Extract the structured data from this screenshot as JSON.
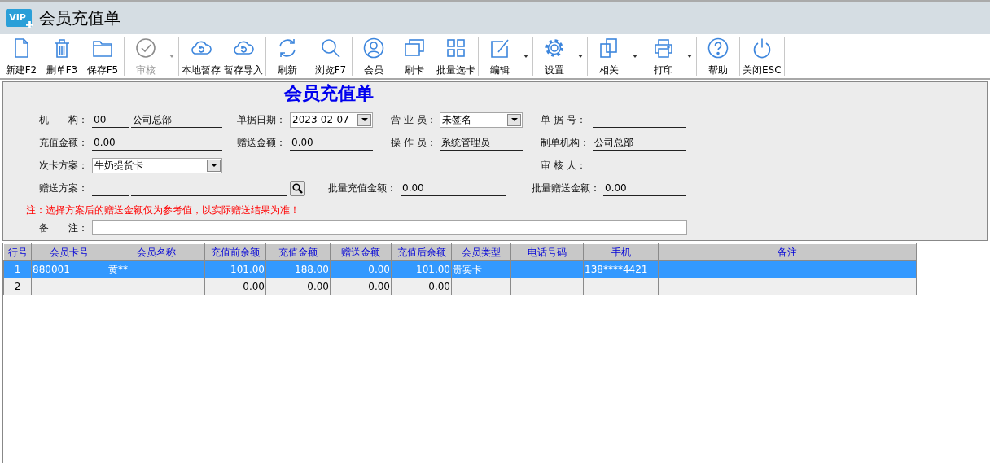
{
  "window": {
    "logo_text": "VIP",
    "title": "会员充值单"
  },
  "toolbar": [
    {
      "buttons": [
        {
          "label": "新建F2",
          "disabled": false,
          "has_menu": false
        },
        {
          "label": "删单F3",
          "disabled": false,
          "has_menu": false
        },
        {
          "label": "保存F5",
          "disabled": false,
          "has_menu": false
        }
      ]
    },
    {
      "buttons": [
        {
          "label": "审核",
          "disabled": true,
          "has_menu": true
        }
      ]
    },
    {
      "buttons": [
        {
          "label": "本地暂存",
          "disabled": false,
          "has_menu": false
        },
        {
          "label": "暂存导入",
          "disabled": false,
          "has_menu": false
        }
      ]
    },
    {
      "buttons": [
        {
          "label": "刷新",
          "disabled": false,
          "has_menu": false
        }
      ]
    },
    {
      "buttons": [
        {
          "label": "浏览F7",
          "disabled": false,
          "has_menu": false
        }
      ]
    },
    {
      "buttons": [
        {
          "label": "会员",
          "disabled": false,
          "has_menu": false
        },
        {
          "label": "刷卡",
          "disabled": false,
          "has_menu": false
        },
        {
          "label": "批量选卡",
          "disabled": false,
          "has_menu": false
        }
      ]
    },
    {
      "buttons": [
        {
          "label": "编辑",
          "disabled": false,
          "has_menu": true
        }
      ]
    },
    {
      "buttons": [
        {
          "label": "设置",
          "disabled": false,
          "has_menu": true
        }
      ]
    },
    {
      "buttons": [
        {
          "label": "相关",
          "disabled": false,
          "has_menu": true
        }
      ]
    },
    {
      "buttons": [
        {
          "label": "打印",
          "disabled": false,
          "has_menu": true
        }
      ]
    },
    {
      "buttons": [
        {
          "label": "帮助",
          "disabled": false,
          "has_menu": false
        }
      ]
    },
    {
      "buttons": [
        {
          "label": "关闭ESC",
          "disabled": false,
          "has_menu": false
        }
      ]
    }
  ],
  "form": {
    "heading": "会员充值单",
    "columns": [
      [
        {
          "label": "机　　构：",
          "kind": "code_name",
          "code": "00",
          "value": "公司总部"
        },
        {
          "label": "充值金额：",
          "kind": "line",
          "value": "0.00"
        },
        {
          "label": "次卡方案：",
          "kind": "select",
          "value": "牛奶提货卡"
        }
      ],
      [
        {
          "label": "单据日期：",
          "kind": "select",
          "value": "2023-02-07"
        },
        {
          "label": "赠送金额：",
          "kind": "line",
          "value": "0.00"
        }
      ],
      [
        {
          "label": "营 业 员：",
          "kind": "select",
          "value": "未签名"
        },
        {
          "label": "操 作 员：",
          "kind": "line",
          "value": "系统管理员"
        }
      ],
      [
        {
          "label": "单 据 号：",
          "kind": "line"
        },
        {
          "label": "制单机构：",
          "kind": "line",
          "value": "公司总部"
        },
        {
          "label": "审 核 人：",
          "kind": "line"
        }
      ]
    ],
    "batch_row": [
      {
        "label": "赠送方案：",
        "kind": "lookup"
      },
      {
        "label": "批量充值金额：",
        "kind": "line",
        "value": "0.00"
      },
      {
        "label": "批量赠送金额：",
        "kind": "line",
        "value": "0.00"
      }
    ],
    "note": "注：选择方案后的赠送金额仅为参考值，以实际赠送结果为准！",
    "remark": {
      "label": "备　　注："
    }
  },
  "table": {
    "columns": [
      "行号",
      "会员卡号",
      "会员名称",
      "充值前余额",
      "充值金额",
      "赠送金额",
      "充值后余额",
      "会员类型",
      "电话号码",
      "手机",
      "备注"
    ],
    "rows": [
      {
        "selected": true,
        "cells": [
          "1",
          "880001",
          "黄**",
          "101.00",
          "188.00",
          "0.00",
          "101.00",
          "贵宾卡",
          null,
          "138****4421",
          null
        ]
      },
      {
        "selected": false,
        "cells": [
          "2",
          null,
          null,
          "0.00",
          "0.00",
          "0.00",
          "0.00",
          null,
          null,
          null,
          null
        ]
      }
    ]
  }
}
